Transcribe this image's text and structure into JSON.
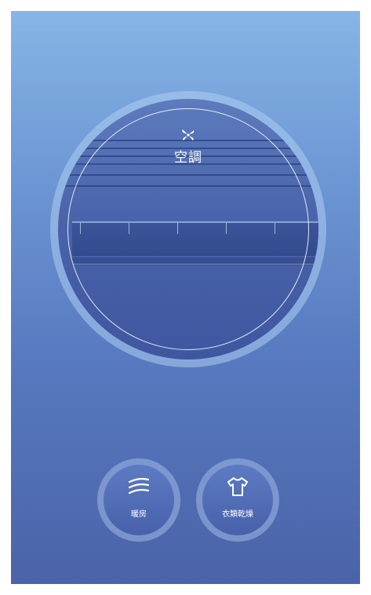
{
  "main_mode": {
    "title": "空調",
    "icon": "fan-icon"
  },
  "mode_buttons": [
    {
      "label": "暖房",
      "icon": "heat-waves-icon"
    },
    {
      "label": "衣類乾燥",
      "icon": "shirt-icon"
    }
  ],
  "colors": {
    "background_top": "#86b5e6",
    "background_bottom": "#4b63a8",
    "disc": "#4a64ab",
    "text": "#ffffff"
  }
}
